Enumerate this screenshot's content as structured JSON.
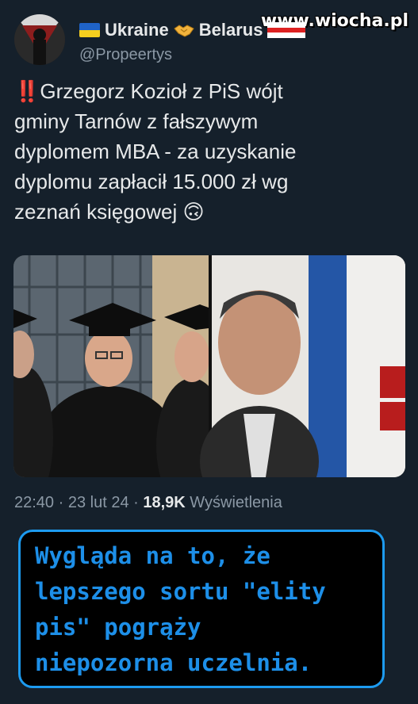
{
  "watermark": "www.wiocha.pl",
  "author": {
    "name": "Ukraine",
    "name_part2": "Belarus",
    "handle": "@Propeertys"
  },
  "tweet": {
    "text": "‼️Grzegorz Kozioł z PiS wójt\ngminy Tarnów z fałszywym\ndyplomem MBA - za uzyskanie\ndyplomu zapłacił 15.000 zł wg\nzeznań księgowej 🙃"
  },
  "meta": {
    "time": "22:40",
    "date": "23 lut 24",
    "views_count": "18,9K",
    "views_label": "Wyświetlenia"
  },
  "callout": {
    "text": "Wygląda na to, że\nlepszego sortu \"elity\npis\" pogrąży\nniepozorna uczelnia."
  },
  "colors": {
    "background": "#15202b",
    "callout_border": "#1d9bf0",
    "callout_text": "#1d8fe8"
  },
  "icons": [
    "flag-ukraine-icon",
    "handshake-icon",
    "flag-belarus-icon"
  ]
}
